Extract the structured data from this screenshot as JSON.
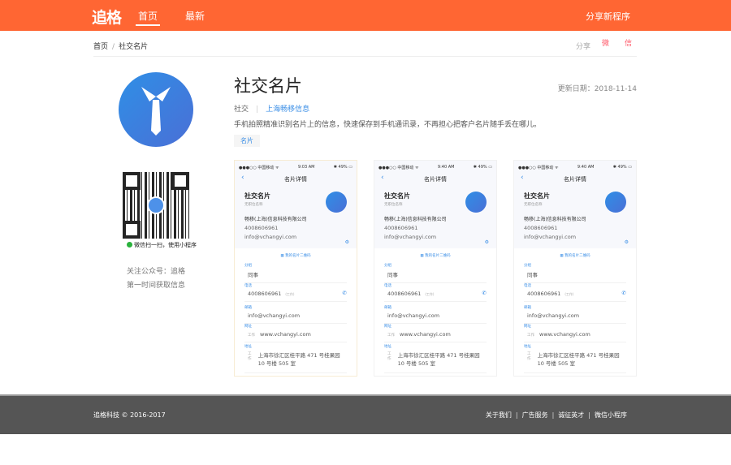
{
  "header": {
    "logo": "追格",
    "nav": [
      "首页",
      "最新"
    ],
    "share_mini": "分享新程序"
  },
  "breadcrumb": {
    "home": "首页",
    "sep": "/",
    "current": "社交名片"
  },
  "share": {
    "label": "分享",
    "weibo": "微",
    "wechat": "信"
  },
  "sidebar": {
    "qr_tip": "微信扫一扫，使用小程序",
    "follow_line1": "关注公众号：追格",
    "follow_line2": "第一时间获取信息"
  },
  "app": {
    "title": "社交名片",
    "updated": "更新日期：2018-11-14",
    "category": "社交",
    "developer": "上海畅移信息",
    "description": "手机拍照精准识别名片上的信息，快速保存到手机通讯录，不再担心把客户名片随手丢在哪儿。",
    "tag": "名片"
  },
  "screens": [
    {
      "carrier": "●●●○○ 中国移动 ᯤ",
      "time": "9:03 AM",
      "battery": "✱ 49% ▭",
      "nav_title": "名片详情",
      "name": "社交名片",
      "position": "无职位名称",
      "company": "畅移(上海)信息科技有限公司",
      "phone": "4008606961",
      "email": "info@vchangyi.com",
      "qr_link": "我的名片二维码",
      "group_label": "分组",
      "group": "同事",
      "phone_label": "电话",
      "phone_type": "(工作)",
      "email_label": "邮箱",
      "web_label": "网址",
      "web_type": "工作",
      "web": "www.vchangyi.com",
      "addr_label": "地址",
      "addr_type": "工作",
      "addr": "上海市徐汇区桂平路 471 号桂果园 10 号楼 505 室"
    },
    {
      "carrier": "●●●○○ 中国移动 ᯤ",
      "time": "9:40 AM",
      "battery": "✱ 49% ▭",
      "nav_title": "名片详情",
      "name": "社交名片",
      "position": "无职位名称",
      "company": "畅移(上海)信息科技有限公司",
      "phone": "4008606961",
      "email": "info@vchangyi.com",
      "qr_link": "我的名片二维码",
      "group_label": "分组",
      "group": "同事",
      "phone_label": "电话",
      "phone_type": "(工作)",
      "email_label": "邮箱",
      "web_label": "网址",
      "web_type": "工作",
      "web": "www.vchangyi.com",
      "addr_label": "地址",
      "addr_type": "工作",
      "addr": "上海市徐汇区桂平路 471 号桂果园 10 号楼 505 室"
    },
    {
      "carrier": "●●●○○ 中国移动 ᯤ",
      "time": "9:40 AM",
      "battery": "✱ 49% ▭",
      "nav_title": "名片详情",
      "name": "社交名片",
      "position": "无职位名称",
      "company": "畅移(上海)信息科技有限公司",
      "phone": "4008606961",
      "email": "info@vchangyi.com",
      "qr_link": "我的名片二维码",
      "group_label": "分组",
      "group": "同事",
      "phone_label": "电话",
      "phone_type": "(工作)",
      "email_label": "邮箱",
      "web_label": "网址",
      "web_type": "工作",
      "web": "www.vchangyi.com",
      "addr_label": "地址",
      "addr_type": "工作",
      "addr": "上海市徐汇区桂平路 471 号桂果园 10 号楼 505 室"
    }
  ],
  "footer": {
    "copyright": "追格科技 © 2016-2017",
    "links": [
      "关于我们",
      "广告服务",
      "诚征英才",
      "微信小程序"
    ],
    "sep": "|"
  }
}
